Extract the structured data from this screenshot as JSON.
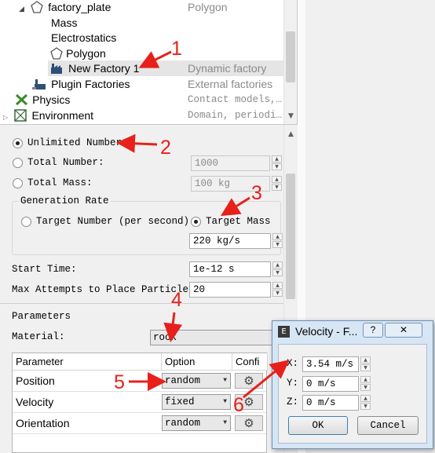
{
  "tree": {
    "rows": [
      {
        "name": "factory_plate",
        "type": "Polygon"
      },
      {
        "name": "Mass",
        "type": ""
      },
      {
        "name": "Electrostatics",
        "type": ""
      },
      {
        "name": "Polygon",
        "type": ""
      },
      {
        "name": "New Factory 1",
        "type": "Dynamic factory"
      },
      {
        "name": "Plugin Factories",
        "type": "External factories"
      },
      {
        "name": "Physics",
        "type": "Contact models,…"
      },
      {
        "name": "Environment",
        "type": "Domain, periodi…"
      }
    ]
  },
  "factory": {
    "unlimited_label": "Unlimited Number",
    "total_number_label": "Total Number:",
    "total_number_value": "1000",
    "total_mass_label": "Total Mass:",
    "total_mass_value": "100 kg",
    "generation_rate_title": "Generation Rate",
    "target_number_label": "Target Number (per second)",
    "target_mass_label": "Target Mass",
    "target_mass_value": "220 kg/s",
    "start_time_label": "Start Time:",
    "start_time_value": "1e-12 s",
    "max_attempts_label": "Max Attempts to Place Particle:",
    "max_attempts_value": "20"
  },
  "parameters": {
    "title": "Parameters",
    "material_label": "Material:",
    "material_value": "rock",
    "columns": [
      "Parameter",
      "Option",
      "Confi"
    ],
    "rows": [
      {
        "parameter": "Position",
        "option": "random"
      },
      {
        "parameter": "Velocity",
        "option": "fixed"
      },
      {
        "parameter": "Orientation",
        "option": "random"
      }
    ]
  },
  "dialog": {
    "title": "Velocity - F...",
    "help": "?",
    "close": "✕",
    "x_label": "X:",
    "x_value": "3.54 m/s",
    "y_label": "Y:",
    "y_value": "0 m/s",
    "z_label": "Z:",
    "z_value": "0 m/s",
    "ok": "OK",
    "cancel": "Cancel"
  },
  "annotations": [
    "1",
    "2",
    "3",
    "4",
    "5",
    "6"
  ],
  "colors": {
    "annotation": "#e8201b",
    "selection": "#e5e5e5"
  }
}
